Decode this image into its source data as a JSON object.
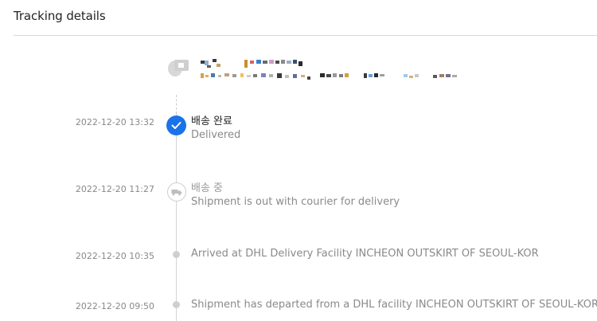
{
  "header": {
    "title": "Tracking details"
  },
  "address": {
    "icon": "map-pin-icon"
  },
  "colors": {
    "accent": "#1a73e8",
    "line": "#d4d4d4",
    "muted_text": "#8a8a8a"
  },
  "events": [
    {
      "timestamp": "2022-12-20 13:32",
      "status_ko": "배송 완료",
      "status_en": "Delivered",
      "icon": "check-icon",
      "state": "current"
    },
    {
      "timestamp": "2022-12-20 11:27",
      "status_ko": "배송 중",
      "status_en": "Shipment is out with courier for delivery",
      "icon": "truck-icon",
      "state": "past"
    },
    {
      "timestamp": "2022-12-20 10:35",
      "status_ko": "",
      "status_en": "Arrived at DHL Delivery Facility INCHEON OUTSKIRT OF SEOUL-KOR",
      "icon": "dot-icon",
      "state": "past"
    },
    {
      "timestamp": "2022-12-20 09:50",
      "status_ko": "",
      "status_en": "Shipment has departed from a DHL facility INCHEON OUTSKIRT OF SEOUL-KOR",
      "icon": "dot-icon",
      "state": "past"
    }
  ]
}
